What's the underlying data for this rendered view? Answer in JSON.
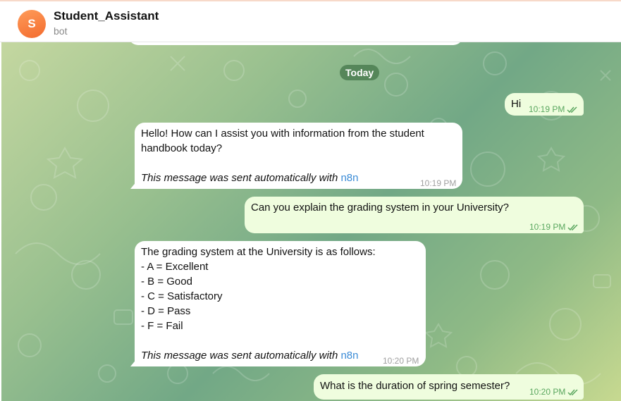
{
  "header": {
    "avatar_letter": "S",
    "title": "Student_Assistant",
    "subtitle": "bot"
  },
  "chat": {
    "date_separator": "Today",
    "messages": [
      {
        "direction": "outgoing",
        "text": "Hi",
        "time": "10:19 PM",
        "status": "read"
      },
      {
        "direction": "incoming",
        "lines": [
          "Hello! How can I assist you with information from the student",
          "handbook today?"
        ],
        "auto_note": "This message was sent automatically with",
        "auto_link": "n8n",
        "time": "10:19 PM"
      },
      {
        "direction": "outgoing",
        "text": "Can you explain the grading system in your University?",
        "time": "10:19 PM",
        "status": "read"
      },
      {
        "direction": "incoming",
        "lines": [
          "The grading system at the University is as follows:",
          "- A = Excellent",
          "- B = Good",
          "- C = Satisfactory",
          "- D = Pass",
          "- F = Fail"
        ],
        "auto_note": "This message was sent automatically with",
        "auto_link": "n8n",
        "time": "10:20 PM"
      },
      {
        "direction": "outgoing",
        "text": "What is the duration of spring semester?",
        "time": "10:20 PM",
        "status": "read"
      }
    ]
  },
  "colors": {
    "incoming_bubble": "#ffffff",
    "outgoing_bubble": "#effdde",
    "read_check": "#5aa75f",
    "link": "#3a8bd6",
    "avatar": "#f47a3a"
  }
}
